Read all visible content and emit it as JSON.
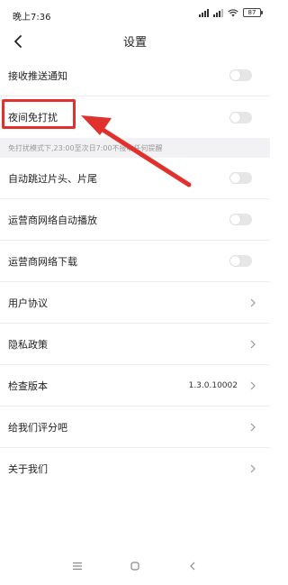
{
  "status_bar": {
    "time": "晚上7:36",
    "battery": "87",
    "icons": [
      "signal-icon",
      "signal-icon-2",
      "wifi-icon",
      "battery-icon"
    ]
  },
  "header": {
    "title": "设置",
    "back_icon": "chevron-left-icon"
  },
  "settings": {
    "push_notifications": {
      "label": "接收推送通知",
      "enabled": false
    },
    "night_dnd": {
      "label": "夜间免打扰",
      "enabled": false
    },
    "dnd_hint": "免打扰模式下,23:00至次日7:00不接收任何提醒",
    "skip_intro": {
      "label": "自动跳过片头、片尾",
      "enabled": false
    },
    "carrier_autoplay": {
      "label": "运营商网络自动播放",
      "enabled": false
    },
    "carrier_download": {
      "label": "运营商网络下载",
      "enabled": false
    },
    "user_agreement": {
      "label": "用户协议"
    },
    "privacy_policy": {
      "label": "隐私政策"
    },
    "check_version": {
      "label": "检查版本",
      "value": "1.3.0.10002"
    },
    "rate_us": {
      "label": "给我们评分吧"
    },
    "about_us": {
      "label": "关于我们"
    }
  },
  "annotation": {
    "color": "#e0312c"
  },
  "bottom_nav": {
    "icons": [
      "menu-icon",
      "home-icon",
      "back-icon"
    ]
  }
}
